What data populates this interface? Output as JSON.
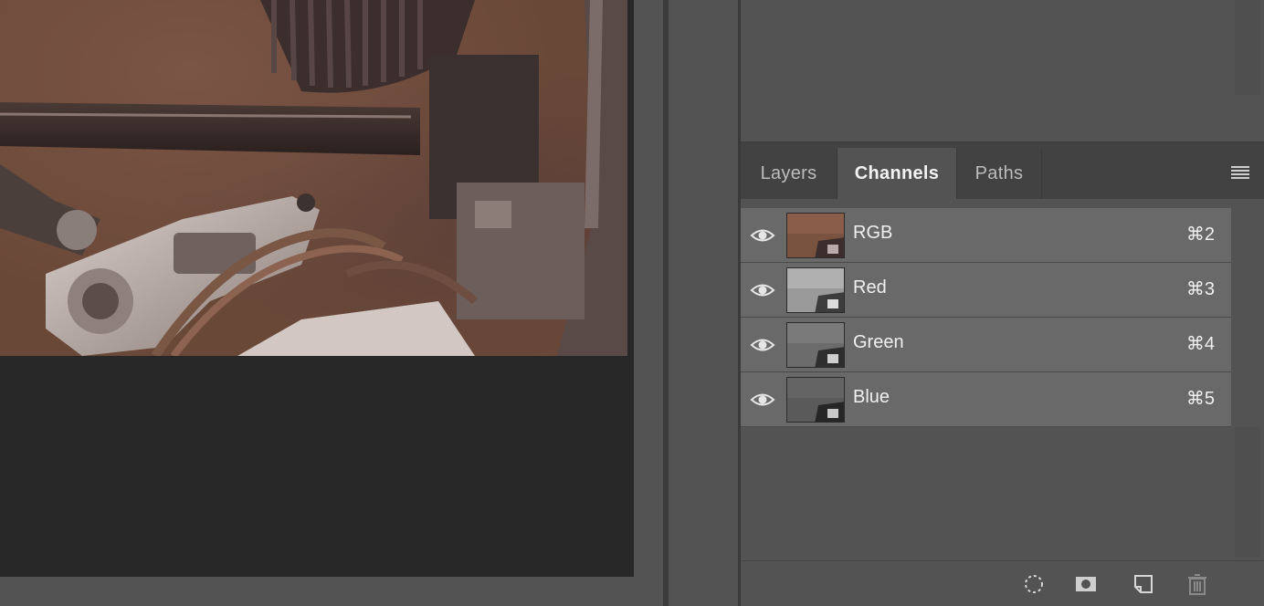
{
  "panel": {
    "tabs": [
      {
        "label": "Layers",
        "active": false
      },
      {
        "label": "Channels",
        "active": true
      },
      {
        "label": "Paths",
        "active": false
      }
    ],
    "menu_icon": "hamburger-menu-icon"
  },
  "channels": [
    {
      "name": "RGB",
      "shortcut": "⌘2",
      "visible": true,
      "thumbnail": "color"
    },
    {
      "name": "Red",
      "shortcut": "⌘3",
      "visible": true,
      "thumbnail": "grayscale-light"
    },
    {
      "name": "Green",
      "shortcut": "⌘4",
      "visible": true,
      "thumbnail": "grayscale-mid"
    },
    {
      "name": "Blue",
      "shortcut": "⌘5",
      "visible": true,
      "thumbnail": "grayscale-dark"
    }
  ],
  "footer_icons": [
    "load-selection-icon",
    "save-selection-mask-icon",
    "new-channel-icon",
    "trash-icon"
  ],
  "colors": {
    "panel_bg": "#535353",
    "row_bg": "#696969",
    "tab_bar_bg": "#424242",
    "canvas_bg": "#282828"
  }
}
